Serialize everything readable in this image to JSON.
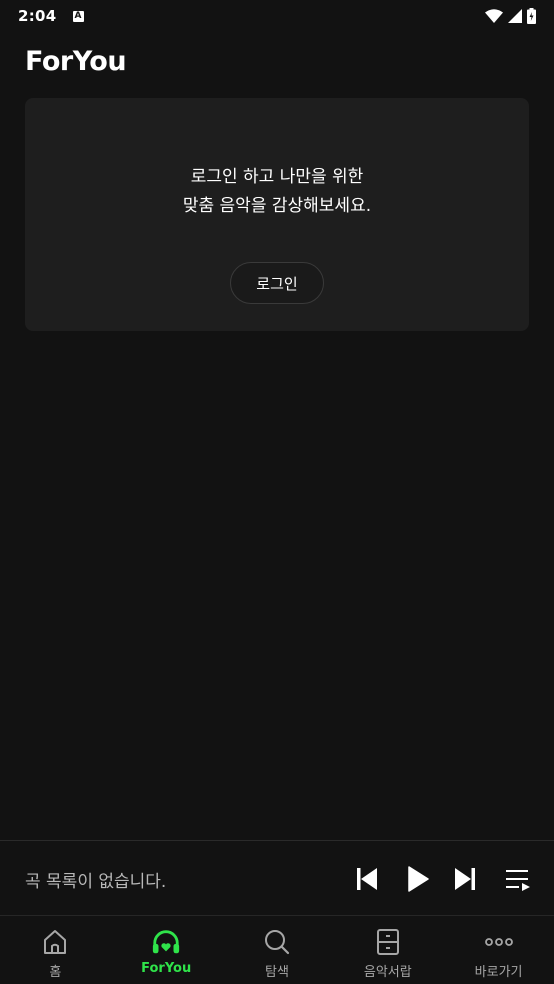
{
  "status_bar": {
    "time": "2:04",
    "notification_icon_letter": "A",
    "icons": [
      "wifi-icon",
      "signal-icon",
      "battery-icon"
    ]
  },
  "page": {
    "title": "ForYou"
  },
  "login_card": {
    "message_line1": "로그인 하고 나만을 위한",
    "message_line2": "맞춤 음악을 감상해보세요.",
    "button_label": "로그인"
  },
  "mini_player": {
    "empty_text": "곡 목록이 없습니다.",
    "controls": [
      "previous-icon",
      "play-icon",
      "next-icon",
      "playlist-icon"
    ]
  },
  "bottom_nav": {
    "items": [
      {
        "label": "홈",
        "icon": "home-icon",
        "active": false
      },
      {
        "label": "ForYou",
        "icon": "headphones-heart-icon",
        "active": true
      },
      {
        "label": "탐색",
        "icon": "search-icon",
        "active": false
      },
      {
        "label": "음악서랍",
        "icon": "drawer-icon",
        "active": false
      },
      {
        "label": "바로가기",
        "icon": "more-icon",
        "active": false
      }
    ]
  },
  "colors": {
    "background": "#121212",
    "card": "#1e1e1e",
    "accent_green": "#2fe34a",
    "inactive": "#a6a6a6"
  }
}
